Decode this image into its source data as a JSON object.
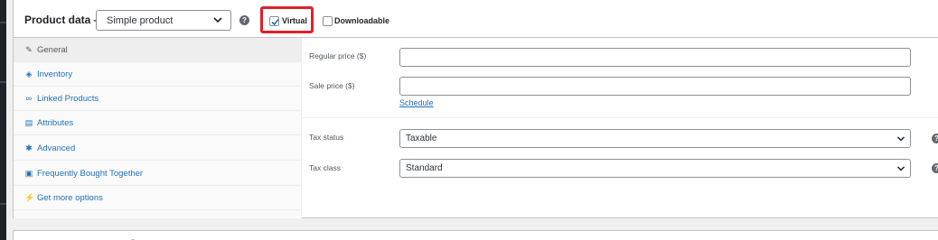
{
  "header": {
    "title": "Product data —",
    "product_type": "Simple product",
    "help_glyph": "?",
    "virtual": {
      "label": "Virtual",
      "checked": true
    },
    "downloadable": {
      "label": "Downloadable",
      "checked": false
    }
  },
  "tabs": [
    {
      "label": "General",
      "icon": "wrench-icon",
      "active": true
    },
    {
      "label": "Inventory",
      "icon": "diamond-icon",
      "active": false
    },
    {
      "label": "Linked Products",
      "icon": "link-icon",
      "active": false
    },
    {
      "label": "Attributes",
      "icon": "list-icon",
      "active": false
    },
    {
      "label": "Advanced",
      "icon": "gear-icon",
      "active": false
    },
    {
      "label": "Frequently Bought Together",
      "icon": "bag-icon",
      "active": false
    },
    {
      "label": "Get more options",
      "icon": "plug-icon",
      "active": false
    }
  ],
  "general": {
    "regular_price_label": "Regular price ($)",
    "regular_price_value": "",
    "sale_price_label": "Sale price ($)",
    "sale_price_value": "",
    "schedule_link": "Schedule",
    "tax_status_label": "Tax status",
    "tax_status_value": "Taxable",
    "tax_class_label": "Tax class",
    "tax_class_value": "Standard"
  },
  "colors": {
    "link": "#2271b1",
    "highlight": "#e0202a",
    "border": "#c3c4c7"
  }
}
